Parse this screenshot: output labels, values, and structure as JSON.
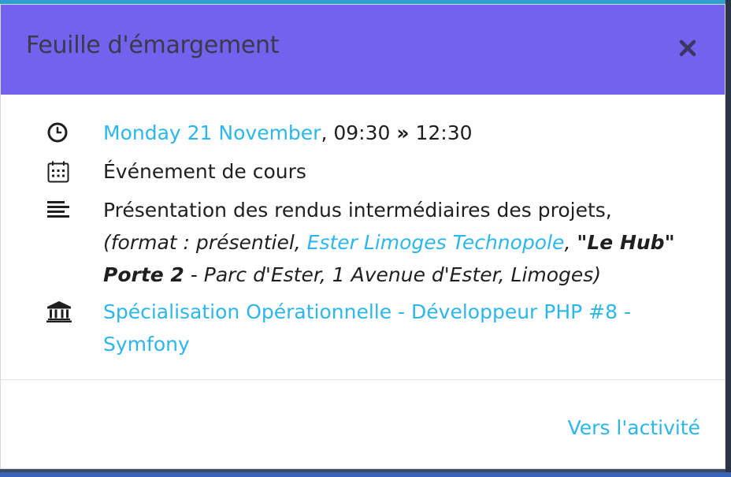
{
  "modal": {
    "title": "Feuille d'émargement",
    "close_icon": "close-icon"
  },
  "event": {
    "date_link": "Monday 21 November",
    "time_sep": ", ",
    "start_time": "09:30",
    "arrow": "»",
    "end_time": "12:30",
    "type": "Événement de cours",
    "description": "Présentation des rendus intermédiaires des projets,",
    "format_prefix": "(format : présentiel, ",
    "location_link": "Ester Limoges Technopole",
    "location_sep": ", ",
    "room": "\"Le Hub\" Porte 2",
    "address": " - Parc d'Ester, 1 Avenue d'Ester, Limoges)",
    "course_link": "Spécialisation Opérationnelle - Développeur PHP #8 - Symfony"
  },
  "footer": {
    "activity_link": "Vers l'activité"
  },
  "icons": {
    "time": "clock-icon",
    "type": "calendar-icon",
    "description": "text-lines-icon",
    "course": "institution-icon"
  },
  "colors": {
    "header": "#7262ed",
    "link": "#2cb6ea",
    "text": "#1f1f1f"
  }
}
